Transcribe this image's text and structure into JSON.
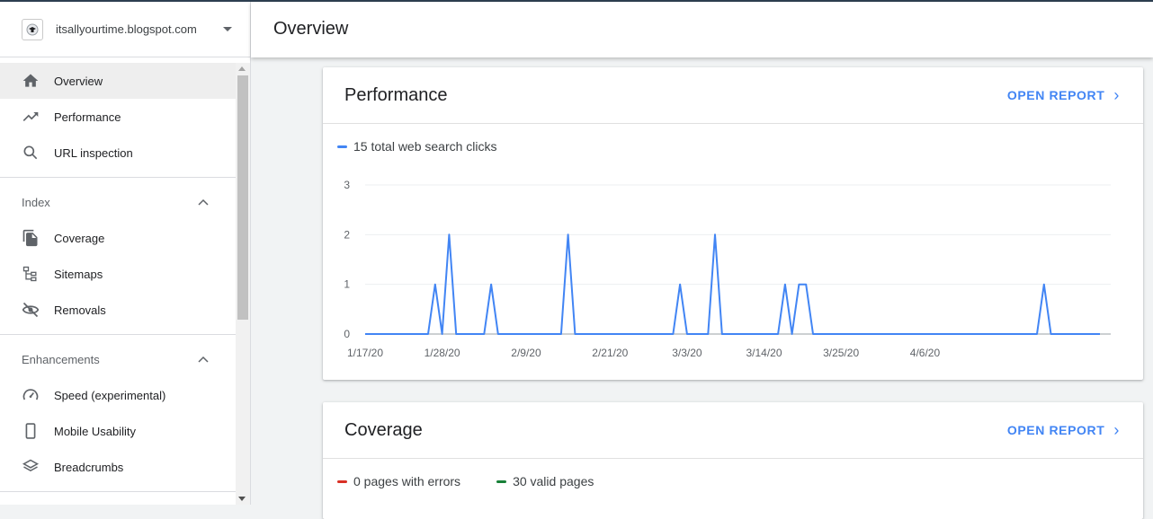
{
  "property": {
    "name": "itsallyourtime.blogspot.com"
  },
  "nav": {
    "top": [
      {
        "label": "Overview",
        "icon": "home-icon",
        "active": true
      },
      {
        "label": "Performance",
        "icon": "trending-up-icon"
      },
      {
        "label": "URL inspection",
        "icon": "search-icon"
      }
    ],
    "index": {
      "title": "Index",
      "items": [
        {
          "label": "Coverage",
          "icon": "coverage-icon"
        },
        {
          "label": "Sitemaps",
          "icon": "sitemap-icon"
        },
        {
          "label": "Removals",
          "icon": "removals-icon"
        }
      ]
    },
    "enhancements": {
      "title": "Enhancements",
      "items": [
        {
          "label": "Speed (experimental)",
          "icon": "speed-icon"
        },
        {
          "label": "Mobile Usability",
          "icon": "mobile-icon"
        },
        {
          "label": "Breadcrumbs",
          "icon": "breadcrumbs-icon"
        }
      ]
    }
  },
  "header": {
    "title": "Overview"
  },
  "performance": {
    "title": "Performance",
    "open_report": "OPEN REPORT",
    "legend": "15 total web search clicks"
  },
  "coverage": {
    "title": "Coverage",
    "open_report": "OPEN REPORT",
    "legend_errors": "0 pages with errors",
    "legend_valid": "30 valid pages"
  },
  "colors": {
    "accent": "#4285f4",
    "series": "#4285f4",
    "errors": "#d93025",
    "valid": "#188038"
  },
  "chart_data": {
    "type": "line",
    "series": [
      {
        "values": [
          0,
          0,
          0,
          0,
          0,
          0,
          0,
          0,
          0,
          0,
          1,
          0,
          2,
          0,
          0,
          0,
          0,
          0,
          1,
          0,
          0,
          0,
          0,
          0,
          0,
          0,
          0,
          0,
          0,
          2,
          0,
          0,
          0,
          0,
          0,
          0,
          0,
          0,
          0,
          0,
          0,
          0,
          0,
          0,
          0,
          1,
          0,
          0,
          0,
          0,
          2,
          0,
          0,
          0,
          0,
          0,
          0,
          0,
          0,
          0,
          1,
          0,
          1,
          1,
          0,
          0,
          0,
          0,
          0,
          0,
          0,
          0,
          0,
          0,
          0,
          0,
          0,
          0,
          0,
          0,
          0,
          0,
          0,
          0,
          0,
          0,
          0,
          0,
          0,
          0,
          0,
          0,
          0,
          0,
          0,
          0,
          0,
          1,
          0,
          0,
          0,
          0,
          0,
          0,
          0,
          0
        ]
      }
    ],
    "x_start": "1/17/20",
    "x_ticks": [
      "1/17/20",
      "1/28/20",
      "2/9/20",
      "2/21/20",
      "3/3/20",
      "3/14/20",
      "3/25/20",
      "4/6/20"
    ],
    "y_ticks": [
      "0",
      "1",
      "2",
      "3"
    ],
    "ylim": [
      0,
      3
    ]
  }
}
